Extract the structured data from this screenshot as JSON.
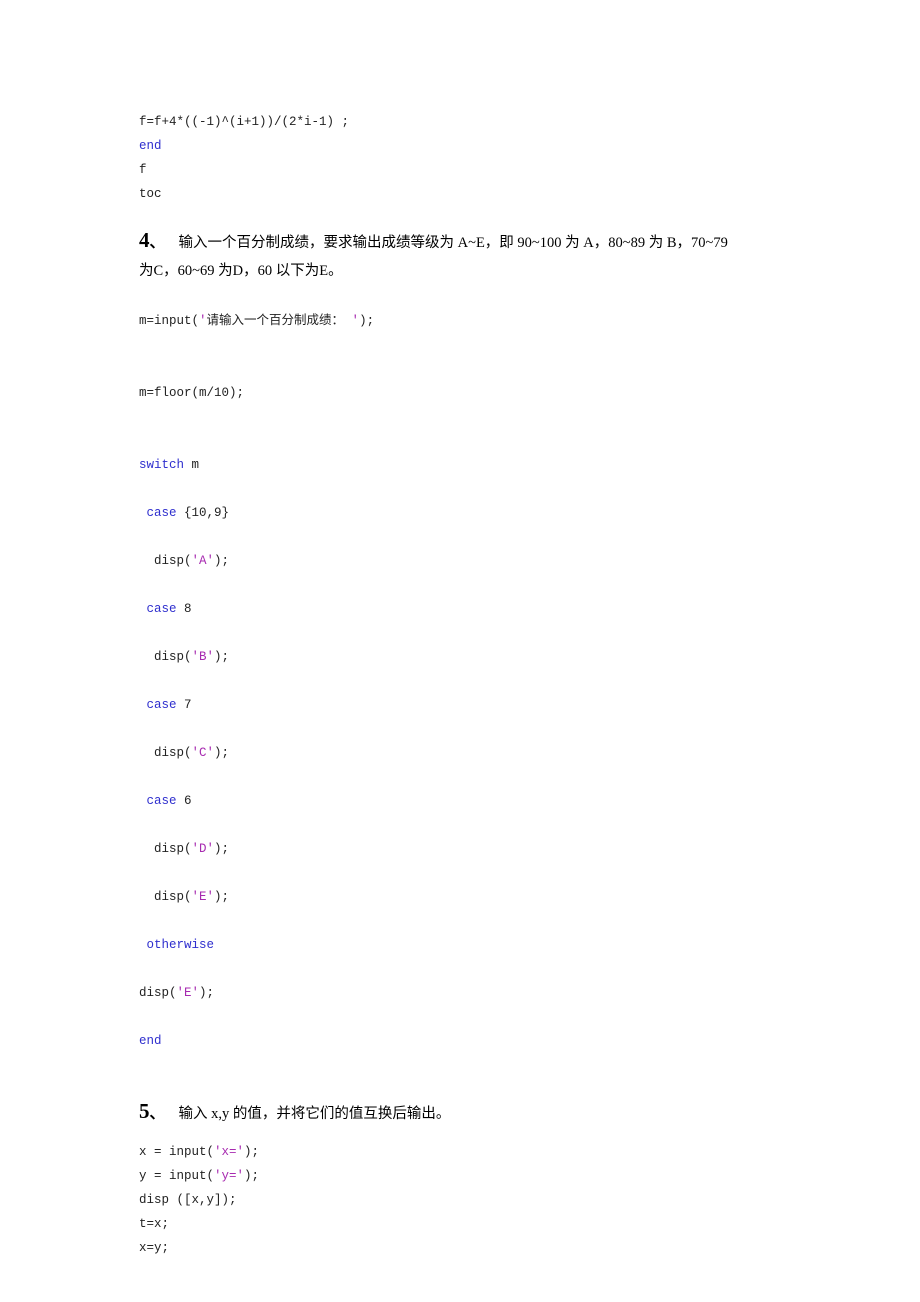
{
  "document": {
    "language": "zh-CN",
    "colors": {
      "background": "#ffffff",
      "text": "#000000",
      "code_text": "#222222",
      "keyword_blue": "#2f2fce",
      "string_magenta": "#a72ab0"
    }
  },
  "block_top": {
    "lines": [
      {
        "segments": [
          {
            "t": "f=f+4*((-1)^(i+1))/(2*i-1) ;",
            "c": "pln"
          }
        ]
      },
      {
        "segments": [
          {
            "t": "end",
            "c": "kw"
          }
        ]
      },
      {
        "segments": [
          {
            "t": "f",
            "c": "pln"
          }
        ]
      },
      {
        "segments": [
          {
            "t": "toc",
            "c": "pln"
          }
        ]
      }
    ]
  },
  "heading4": {
    "number": "4",
    "dun": "、",
    "line1": "输入一个百分制成绩，要求输出成绩等级为 A~E，即 90~100 为 A，80~89 为 B，70~79",
    "line2": "为C，60~69 为D，60 以下为E。"
  },
  "block_input": {
    "lines": [
      {
        "segments": [
          {
            "t": "m=input(",
            "c": "pln"
          },
          {
            "t": "'",
            "c": "str"
          },
          {
            "t": "请输入一个百分制成绩：",
            "c": "pln"
          },
          {
            "t": " '",
            "c": "str"
          },
          {
            "t": ");",
            "c": "pln"
          }
        ]
      }
    ]
  },
  "block_floor": {
    "lines": [
      {
        "segments": [
          {
            "t": "m=floor(m/10);",
            "c": "pln"
          }
        ]
      }
    ]
  },
  "block_switch": {
    "lines": [
      {
        "segments": [
          {
            "t": "switch",
            "c": "kw"
          },
          {
            "t": " m",
            "c": "pln"
          }
        ]
      },
      {
        "segments": [
          {
            "t": " ",
            "c": "pln"
          },
          {
            "t": "case",
            "c": "kw"
          },
          {
            "t": " {10,9}",
            "c": "pln"
          }
        ]
      },
      {
        "segments": [
          {
            "t": "  disp(",
            "c": "pln"
          },
          {
            "t": "'A'",
            "c": "str"
          },
          {
            "t": ");",
            "c": "pln"
          }
        ]
      },
      {
        "segments": [
          {
            "t": " ",
            "c": "pln"
          },
          {
            "t": "case",
            "c": "kw"
          },
          {
            "t": " 8",
            "c": "pln"
          }
        ]
      },
      {
        "segments": [
          {
            "t": "  disp(",
            "c": "pln"
          },
          {
            "t": "'B'",
            "c": "str"
          },
          {
            "t": ");",
            "c": "pln"
          }
        ]
      },
      {
        "segments": [
          {
            "t": " ",
            "c": "pln"
          },
          {
            "t": "case",
            "c": "kw"
          },
          {
            "t": " 7",
            "c": "pln"
          }
        ]
      },
      {
        "segments": [
          {
            "t": "  disp(",
            "c": "pln"
          },
          {
            "t": "'C'",
            "c": "str"
          },
          {
            "t": ");",
            "c": "pln"
          }
        ]
      },
      {
        "segments": [
          {
            "t": " ",
            "c": "pln"
          },
          {
            "t": "case",
            "c": "kw"
          },
          {
            "t": " 6",
            "c": "pln"
          }
        ]
      },
      {
        "segments": [
          {
            "t": "  disp(",
            "c": "pln"
          },
          {
            "t": "'D'",
            "c": "str"
          },
          {
            "t": ");",
            "c": "pln"
          }
        ]
      },
      {
        "segments": [
          {
            "t": "  disp(",
            "c": "pln"
          },
          {
            "t": "'E'",
            "c": "str"
          },
          {
            "t": ");",
            "c": "pln"
          }
        ]
      },
      {
        "segments": [
          {
            "t": " ",
            "c": "pln"
          },
          {
            "t": "otherwise",
            "c": "kw"
          }
        ]
      },
      {
        "segments": [
          {
            "t": "disp(",
            "c": "pln"
          },
          {
            "t": "'E'",
            "c": "str"
          },
          {
            "t": ");",
            "c": "pln"
          }
        ]
      },
      {
        "segments": [
          {
            "t": "end",
            "c": "kw"
          }
        ]
      }
    ]
  },
  "heading5": {
    "number": "5",
    "dun": "、",
    "line1": "输入 x,y 的值，并将它们的值互换后输出。"
  },
  "block_swap": {
    "lines": [
      {
        "segments": [
          {
            "t": "x = input(",
            "c": "pln"
          },
          {
            "t": "'x='",
            "c": "str"
          },
          {
            "t": ");",
            "c": "pln"
          }
        ]
      },
      {
        "segments": [
          {
            "t": "y = input(",
            "c": "pln"
          },
          {
            "t": "'y='",
            "c": "str"
          },
          {
            "t": ");",
            "c": "pln"
          }
        ]
      },
      {
        "segments": [
          {
            "t": "disp ([x,y]);",
            "c": "pln"
          }
        ]
      },
      {
        "segments": [
          {
            "t": "t=x;",
            "c": "pln"
          }
        ]
      },
      {
        "segments": [
          {
            "t": "x=y;",
            "c": "pln"
          }
        ]
      }
    ]
  }
}
